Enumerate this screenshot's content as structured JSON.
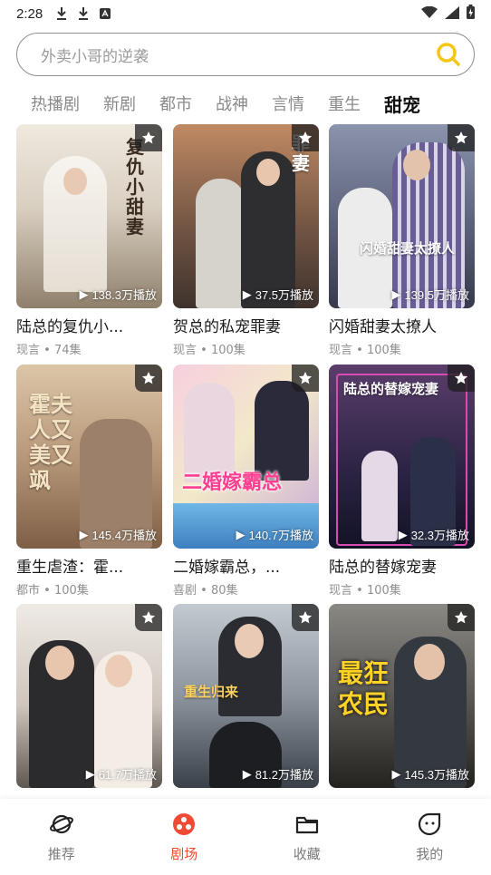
{
  "status": {
    "time": "2:28"
  },
  "search": {
    "placeholder": "外卖小哥的逆袭"
  },
  "tabs": [
    {
      "label": "热播剧",
      "active": false
    },
    {
      "label": "新剧",
      "active": false
    },
    {
      "label": "都市",
      "active": false
    },
    {
      "label": "战神",
      "active": false
    },
    {
      "label": "言情",
      "active": false
    },
    {
      "label": "重生",
      "active": false
    },
    {
      "label": "甜宠",
      "active": true
    }
  ],
  "dramas": [
    {
      "title": "陆总的复仇小...",
      "genre": "现言",
      "episodes": "74集",
      "plays": "138.3万播放",
      "art_text": "陆总的复仇小甜妻",
      "bg_top": "#e9e2d6",
      "bg_bottom": "#9a8c7a"
    },
    {
      "title": "贺总的私宠罪妻",
      "genre": "现言",
      "episodes": "100集",
      "plays": "37.5万播放",
      "art_text": "私宠罪妻",
      "bg_top": "#b77d57",
      "bg_bottom": "#4a3a33"
    },
    {
      "title": "闪婚甜妻太撩人",
      "genre": "现言",
      "episodes": "100集",
      "plays": "139.5万播放",
      "art_text": "闪婚甜妻太撩人",
      "bg_top": "#7e8aa6",
      "bg_bottom": "#3a3f52"
    },
    {
      "title": "重生虐渣：霍...",
      "genre": "都市",
      "episodes": "100集",
      "plays": "145.4万播放",
      "art_text": "霍夫人又美又飒",
      "bg_top": "#d7c0a1",
      "bg_bottom": "#8e6d4f"
    },
    {
      "title": "二婚嫁霸总，...",
      "genre": "喜剧",
      "episodes": "80集",
      "plays": "140.7万播放",
      "art_text": "二婚嫁霸总",
      "bg_top": "#f3c4d8",
      "bg_bottom": "#8c6a8a"
    },
    {
      "title": "陆总的替嫁宠妻",
      "genre": "现言",
      "episodes": "100集",
      "plays": "32.3万播放",
      "art_text": "陆总的替嫁宠妻",
      "bg_top": "#5a3e6b",
      "bg_bottom": "#1c1b34"
    },
    {
      "title": "",
      "genre": "",
      "episodes": "",
      "plays": "61.7万播放",
      "art_text": "",
      "bg_top": "#e6e3df",
      "bg_bottom": "#5b5550"
    },
    {
      "title": "",
      "genre": "",
      "episodes": "",
      "plays": "81.2万播放",
      "art_text": "重生归来",
      "bg_top": "#b9c1c8",
      "bg_bottom": "#3d434b"
    },
    {
      "title": "",
      "genre": "",
      "episodes": "",
      "plays": "145.3万播放",
      "art_text": "最狂农民",
      "bg_top": "#7f7d78",
      "bg_bottom": "#2c2b29"
    }
  ],
  "nav": [
    {
      "label": "推荐",
      "icon": "planet-icon",
      "active": false
    },
    {
      "label": "剧场",
      "icon": "theater-icon",
      "active": true
    },
    {
      "label": "收藏",
      "icon": "folder-icon",
      "active": false
    },
    {
      "label": "我的",
      "icon": "profile-icon",
      "active": false
    }
  ],
  "colors": {
    "accent": "#ef4a33",
    "search_icon": "#f5c518"
  }
}
